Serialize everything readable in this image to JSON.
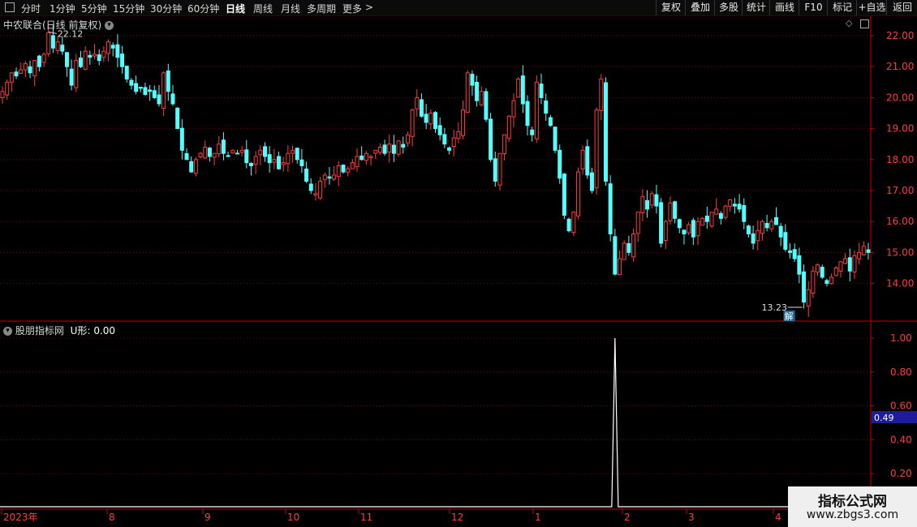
{
  "toolbar": {
    "collapse_icon": "collapse-icon",
    "periods": [
      "分时",
      "1分钟",
      "5分钟",
      "15分钟",
      "30分钟",
      "60分钟",
      "日线",
      "周线",
      "月线",
      "多周期",
      "更多"
    ],
    "active_period": "日线",
    "more_arrow": ">",
    "buttons": [
      "复权",
      "叠加",
      "多股",
      "统计",
      "画线",
      "F10",
      "标记",
      "+自选",
      "返回"
    ]
  },
  "main_panel": {
    "title": "中农联合(日线 前复权)",
    "max_label": "22.12",
    "min_label": "13.23",
    "badge": "解"
  },
  "indicator_panel": {
    "title": "股朋指标网",
    "value_label": "U形: 0.00",
    "cursor_value": "0.49"
  },
  "watermark": {
    "title": "指标公式网",
    "url": "www.zbgs3.com"
  },
  "colors": {
    "up": "#ff3c3c",
    "down": "#54ffff",
    "axis": "#c80000",
    "grid": "#7a0000",
    "text": "#c8c8c8",
    "indicator": "#ffffff",
    "cursor_box": "#1c1c9c"
  },
  "chart_data": [
    {
      "type": "candlestick",
      "title": "中农联合(日线 前复权)",
      "ylim": [
        13,
        22.5
      ],
      "y_ticks": [
        "22.00",
        "21.00",
        "20.00",
        "19.00",
        "18.00",
        "17.00",
        "16.00",
        "15.00",
        "14.00"
      ],
      "x_ticks": [
        "2023年",
        "8",
        "9",
        "10",
        "11",
        "12",
        "1",
        "2",
        "3",
        "4"
      ],
      "annotations": [
        {
          "text": "22.12",
          "value": 22.12,
          "type": "max"
        },
        {
          "text": "13.23",
          "value": 13.23,
          "type": "min"
        }
      ],
      "closes": [
        20.2,
        20.5,
        20.8,
        20.7,
        20.9,
        21.1,
        20.8,
        21.2,
        21.0,
        21.4,
        22.1,
        21.6,
        21.8,
        21.5,
        21.0,
        20.4,
        21.2,
        21.0,
        21.5,
        21.3,
        21.4,
        21.2,
        21.5,
        21.8,
        21.6,
        21.3,
        21.0,
        20.6,
        20.4,
        20.2,
        20.3,
        20.1,
        20.2,
        20.0,
        19.8,
        20.8,
        20.2,
        19.8,
        19.0,
        18.3,
        18.0,
        17.6,
        18.0,
        18.2,
        18.4,
        18.1,
        18.2,
        18.5,
        18.2,
        18.1,
        18.3,
        18.2,
        18.3,
        17.9,
        17.8,
        18.1,
        18.3,
        18.1,
        17.9,
        18.0,
        17.7,
        17.9,
        18.2,
        18.3,
        18.0,
        17.8,
        17.3,
        17.0,
        16.9,
        17.3,
        17.5,
        17.4,
        17.5,
        17.8,
        17.6,
        17.7,
        17.9,
        18.1,
        18.0,
        18.2,
        18.1,
        18.3,
        18.4,
        18.2,
        18.5,
        18.2,
        18.6,
        18.4,
        18.8,
        19.6,
        20.0,
        19.4,
        19.2,
        19.5,
        19.0,
        18.8,
        18.5,
        18.3,
        18.7,
        18.9,
        19.6,
        20.8,
        20.4,
        19.9,
        20.2,
        19.3,
        18.0,
        17.3,
        18.2,
        18.8,
        19.4,
        19.9,
        20.6,
        19.8,
        19.1,
        18.8,
        20.5,
        20.0,
        19.5,
        19.1,
        18.3,
        17.4,
        16.2,
        15.7,
        16.3,
        17.6,
        18.3,
        17.5,
        17.0,
        19.6,
        20.6,
        17.3,
        15.6,
        14.3,
        14.8,
        15.3,
        15.0,
        15.6,
        16.3,
        16.8,
        16.4,
        16.9,
        16.5,
        15.3,
        16.0,
        16.6,
        16.1,
        15.8,
        15.6,
        15.9,
        15.5,
        16.0,
        16.1,
        16.0,
        16.3,
        16.4,
        16.1,
        16.5,
        16.7,
        16.5,
        16.4,
        16.0,
        15.6,
        15.3,
        15.7,
        16.0,
        15.8,
        16.0,
        15.9,
        15.5,
        15.1,
        15.0,
        14.8,
        14.3,
        13.4,
        13.8,
        14.4,
        14.6,
        14.2,
        14.0,
        14.2,
        14.5,
        14.7,
        14.8,
        14.4,
        14.9,
        15.0,
        15.2,
        15.0
      ]
    },
    {
      "type": "line",
      "title": "股朋指标网",
      "series": [
        {
          "name": "U形",
          "spike_index": 133,
          "spike_value": 1.0,
          "baseline": 0.0
        }
      ],
      "ylim": [
        0,
        1.05
      ],
      "y_ticks": [
        "1.00",
        "0.80",
        "0.60",
        "0.40",
        "0.20"
      ]
    }
  ]
}
